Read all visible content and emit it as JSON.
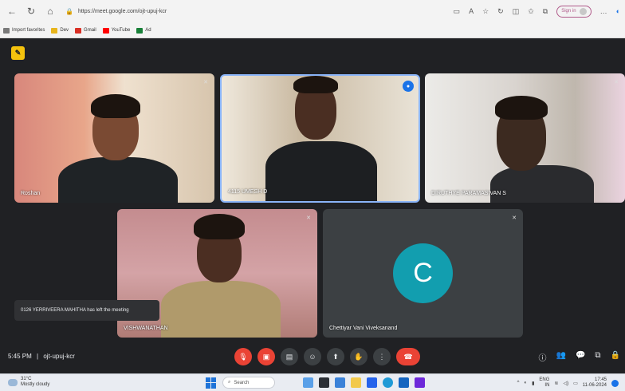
{
  "browser": {
    "url": "https://meet.google.com/ojt-upuj-kcr",
    "signin_label": "Sign in",
    "bookmarks": [
      {
        "label": "Import favorites",
        "color": "#7a7a7a"
      },
      {
        "label": "Dev",
        "color": "#e8b51c"
      },
      {
        "label": "Gmail",
        "color": "#d93025"
      },
      {
        "label": "YouTube",
        "color": "#ff0000"
      },
      {
        "label": "Ad",
        "color": "#188038"
      }
    ]
  },
  "participants": [
    {
      "name": "Roshan",
      "mic_icon": "mic-off-icon"
    },
    {
      "name": "4115 UMESH D",
      "speaking": true
    },
    {
      "name": "DIRUTHYE PARAMASIVAN S",
      "mic_icon": "mic-off-icon"
    },
    {
      "name": "VISHWANATHAN",
      "mic_icon": "mic-off-icon"
    },
    {
      "name": "Chettiyar Vani Viveksanand",
      "avatar_letter": "C",
      "avatar_color": "#129eaf",
      "mic_icon": "mic-off-icon"
    }
  ],
  "toast": "0126 YERRIVEERA MAHITHA has left the meeting",
  "meeting": {
    "time": "5:45 PM",
    "separator": "|",
    "code": "ojt-upuj-kcr"
  },
  "taskbar": {
    "temp": "31°C",
    "weather": "Mostly cloudy",
    "search": "Search",
    "lang": "ENG",
    "lang_sub": "IN",
    "time": "17:45",
    "date": "11-06-2024"
  },
  "colors": {
    "accent": "#1a73e8",
    "end_call": "#ea4335",
    "badge": "#f4c20d"
  }
}
